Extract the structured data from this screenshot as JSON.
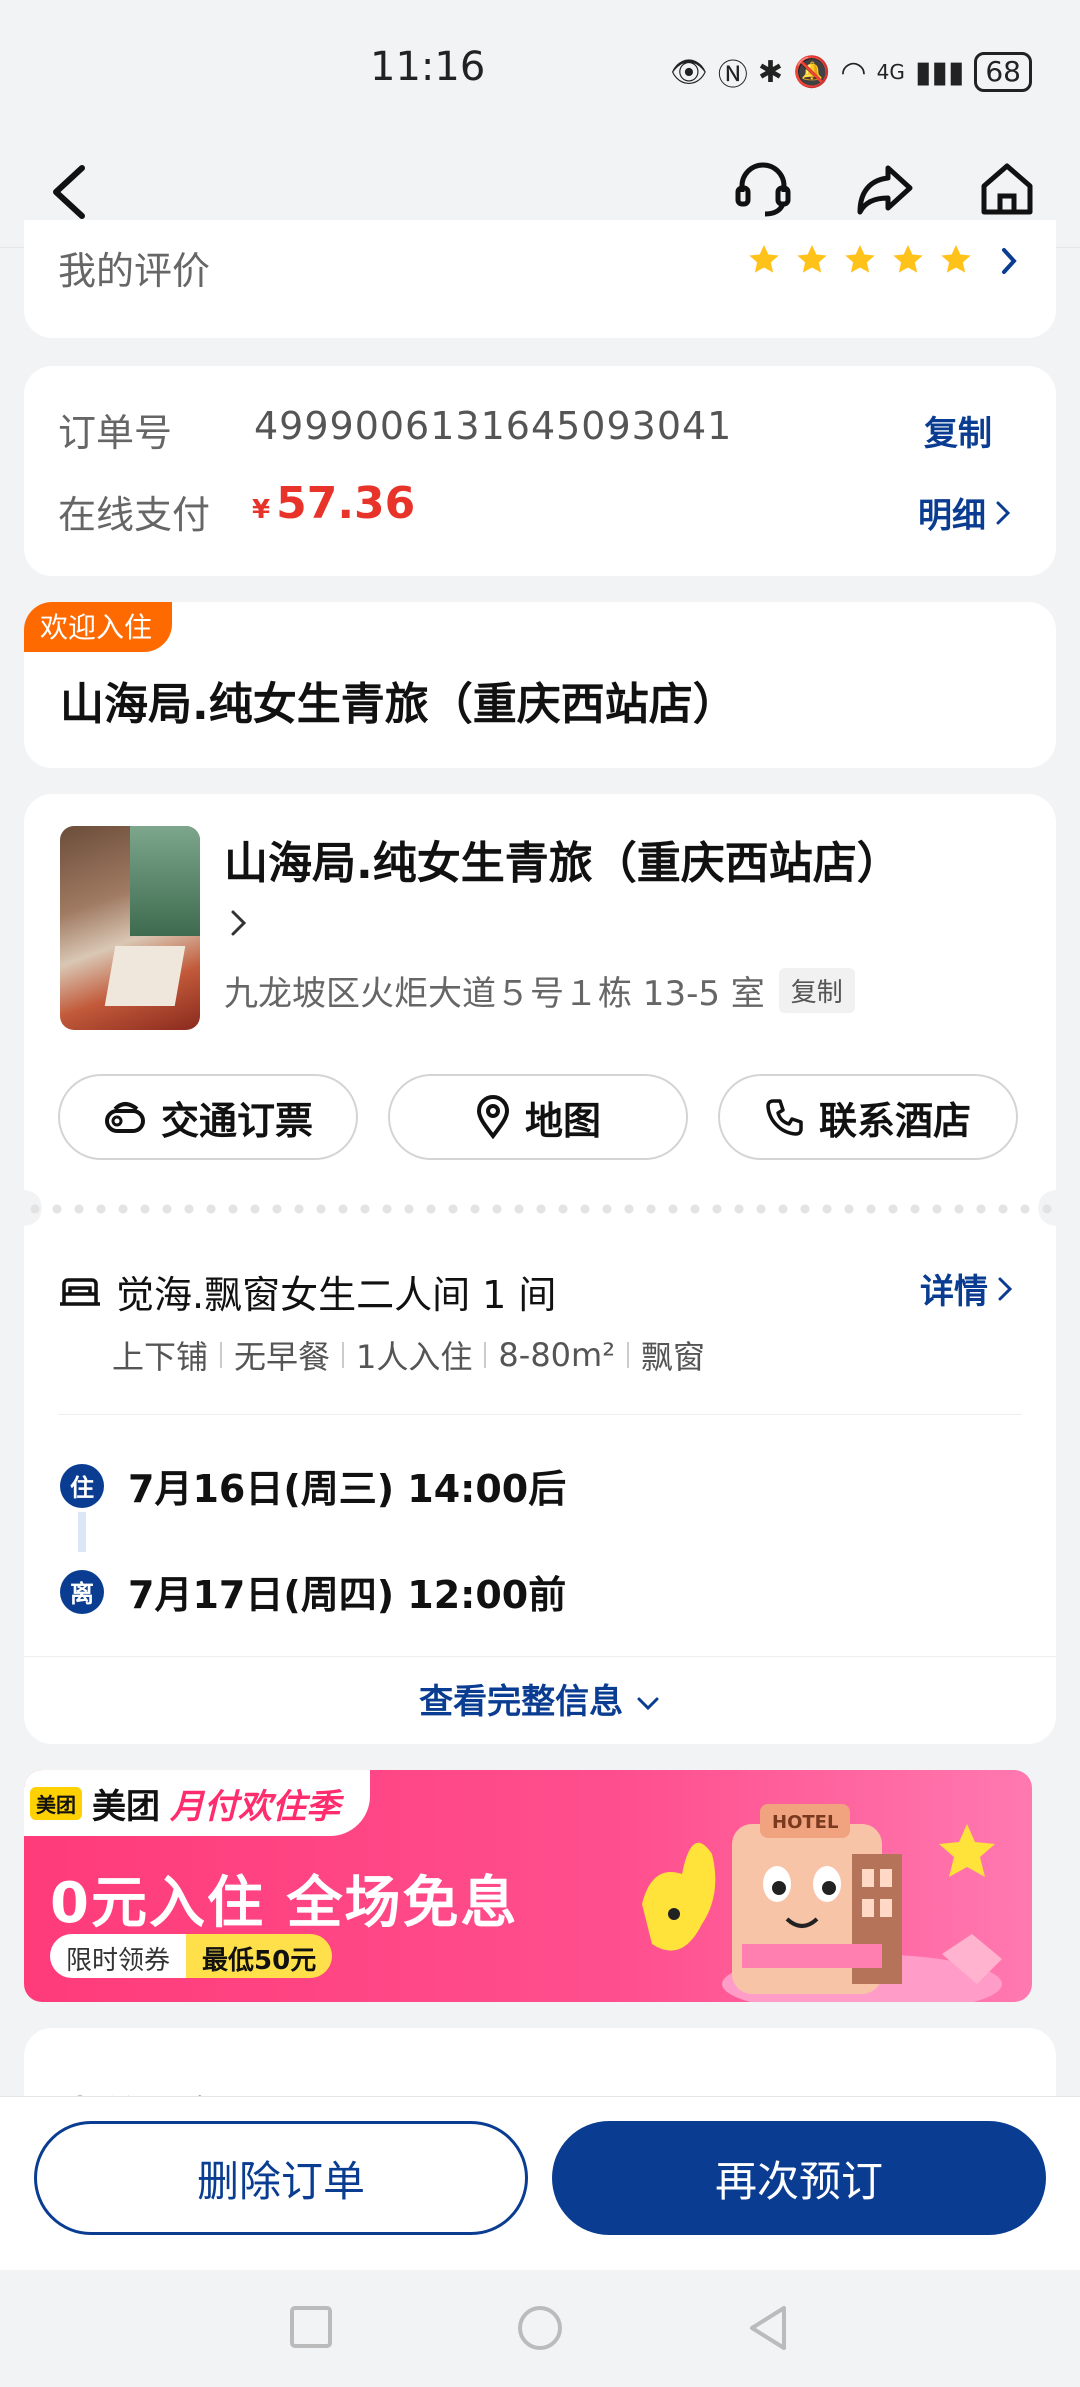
{
  "status": {
    "time": "11:16",
    "battery": "68",
    "network": "4G"
  },
  "review": {
    "label": "我的评价",
    "stars": 5
  },
  "order": {
    "number_label": "订单号",
    "number": "4999006131645093041",
    "copy_label": "复制",
    "pay_label": "在线支付",
    "currency": "¥",
    "amount": "57.36",
    "detail_label": "明细"
  },
  "hotel_header": {
    "badge": "欢迎入住",
    "name": "山海局.纯女生青旅（重庆西站店）"
  },
  "hotel": {
    "name": "山海局.纯女生青旅（重庆西站店）",
    "address": "九龙坡区火炬大道５号１栋 13-5 室",
    "copy_label": "复制",
    "actions": [
      {
        "label": "交通订票",
        "icon": "transport-icon"
      },
      {
        "label": "地图",
        "icon": "map-pin-icon"
      },
      {
        "label": "联系酒店",
        "icon": "phone-icon"
      }
    ],
    "room_name": "觉海.飘窗女生二人间 1 间",
    "room_details_label": "详情",
    "room_tags": [
      "上下铺",
      "无早餐",
      "1人入住",
      "8-80m²",
      "飘窗"
    ],
    "checkin_badge": "住",
    "checkin": "7月16日(周三) 14:00后",
    "checkout_badge": "离",
    "checkout": "7月17日(周四) 12:00前",
    "more_label": "查看完整信息"
  },
  "banner": {
    "brand": "美团",
    "logo_text": "美团",
    "slogan": "月付欢住季",
    "headline": "0元入住 全场免息",
    "coupon_a": "限时领券",
    "coupon_b": "最低50元",
    "hotel_sign": "HOTEL"
  },
  "next_section": {
    "title": "未单下定"
  },
  "bottom": {
    "delete_label": "删除订单",
    "rebook_label": "再次预订"
  },
  "colors": {
    "accent": "#0a3d91",
    "price": "#e8332a",
    "welcome": "#ff6a00",
    "banner": "#ff3b7a"
  }
}
